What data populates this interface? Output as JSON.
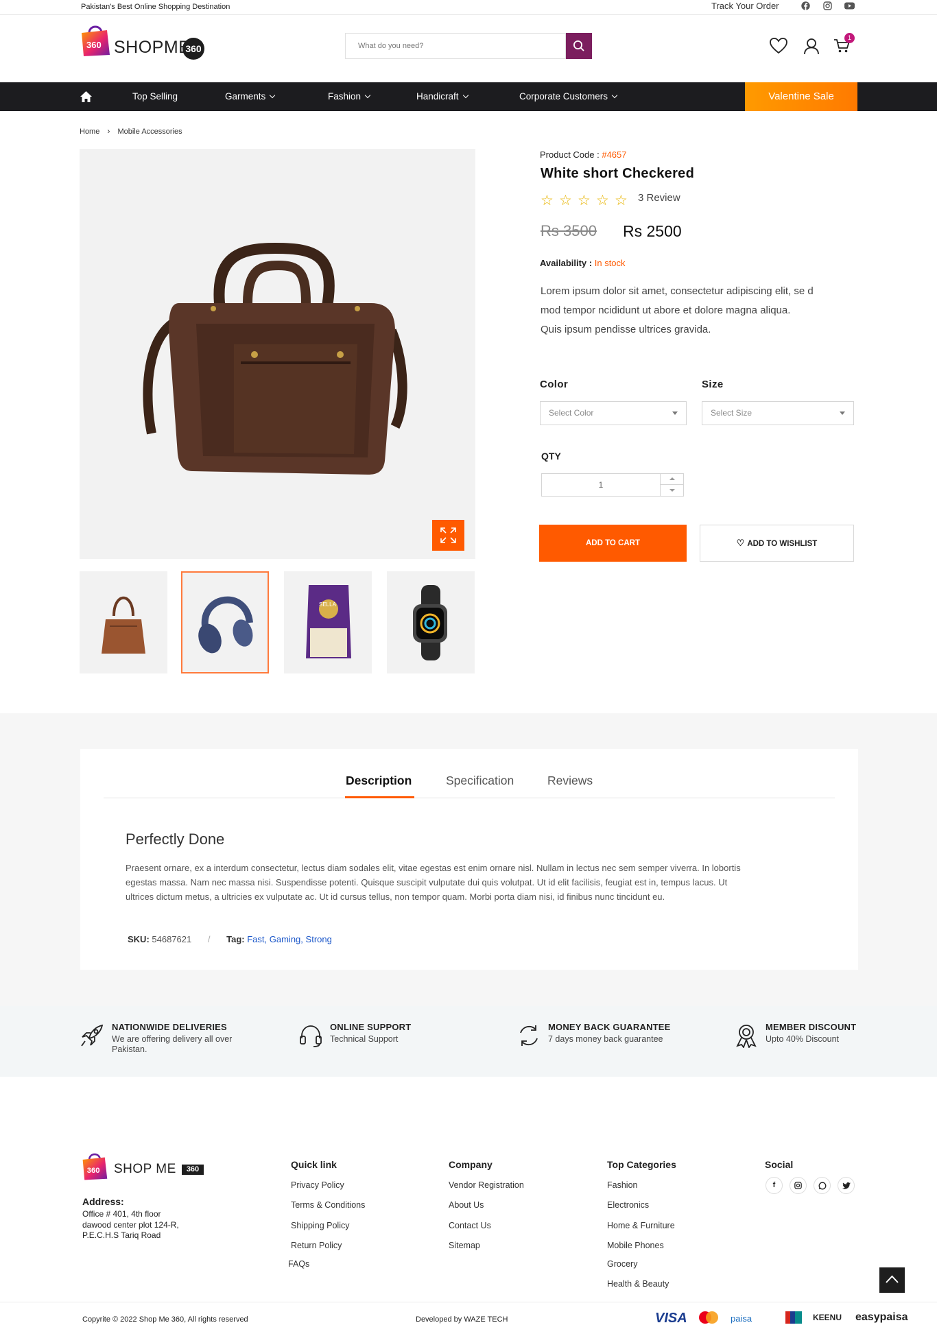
{
  "topbar": {
    "tagline": "Pakistan's Best Online Shopping Destination",
    "track_order": "Track Your Order"
  },
  "header": {
    "brand": "SHOPME",
    "brand_badge": "360",
    "search_placeholder": "What do you need?",
    "cart_count": "1"
  },
  "nav": {
    "items": [
      "Top Selling",
      "Garments",
      "Fashion",
      "Handicraft",
      "Corporate Customers"
    ],
    "sale": "Valentine Sale"
  },
  "breadcrumb": {
    "home": "Home",
    "current": "Mobile Accessories"
  },
  "product": {
    "code_label": "Product Code :",
    "code_value": "#4657",
    "title": "White short Checkered",
    "reviews": "3 Review",
    "rating": 0,
    "old_price": "Rs 3500",
    "price": "Rs 2500",
    "availability_label": "Availability :",
    "availability_value": "In stock",
    "summary_1": "Lorem ipsum dolor sit amet, consectetur adipiscing elit, se d",
    "summary_2": "mod tempor ncididunt ut abore et dolore magna aliqua.",
    "summary_3": "Quis ipsum pendisse ultrices gravida.",
    "color_label": "Color",
    "color_placeholder": "Select Color",
    "size_label": "Size",
    "size_placeholder": "Select Size",
    "qty_label": "QTY",
    "qty_value": "1",
    "add_to_cart": "ADD TO CART",
    "add_to_wishlist": "ADD TO WISHLIST"
  },
  "tabs": {
    "items": [
      "Description",
      "Specification",
      "Reviews"
    ],
    "active": "Description"
  },
  "description": {
    "heading": "Perfectly Done",
    "line_1": "Praesent ornare, ex a interdum consectetur, lectus diam sodales elit, vitae egestas est enim ornare nisl. Nullam in lectus nec sem semper viverra. In lobortis",
    "line_2": "egestas massa. Nam nec massa nisi. Suspendisse potenti. Quisque suscipit vulputate dui quis volutpat. Ut id elit facilisis, feugiat est in, tempus lacus. Ut",
    "line_3": "ultrices dictum metus, a ultricies ex vulputate ac. Ut id cursus tellus, non tempor quam. Morbi porta diam nisi, id finibus nunc tincidunt eu.",
    "sku_label": "SKU:",
    "sku_value": "54687621",
    "separator": "/",
    "tag_label": "Tag:",
    "tags": [
      "Fast,",
      "Gaming,",
      "Strong"
    ]
  },
  "features": [
    {
      "title": "NATIONWIDE DELIVERIES",
      "sub_1": "We are offering delivery all over",
      "sub_2": "Pakistan.",
      "icon": "rocket-icon"
    },
    {
      "title": "ONLINE SUPPORT",
      "sub_1": "Technical Support",
      "sub_2": "",
      "icon": "headset-icon"
    },
    {
      "title": "MONEY BACK GUARANTEE",
      "sub_1": "7 days money back guarantee",
      "sub_2": "",
      "icon": "refresh-icon"
    },
    {
      "title": "MEMBER DISCOUNT",
      "sub_1": "Upto 40% Discount",
      "sub_2": "",
      "icon": "award-icon"
    }
  ],
  "footer": {
    "brand": "SHOP ME",
    "brand_badge": "360",
    "address_label": "Address:",
    "address_1": "Office # 401, 4th floor",
    "address_2": "dawood center plot 124-R,",
    "address_3": "P.E.C.H.S Tariq Road",
    "quick_title": "Quick link",
    "quick": [
      "Privacy Policy",
      "Terms & Conditions",
      "Shipping Policy",
      "Return Policy",
      "FAQs"
    ],
    "company_title": "Company",
    "company": [
      "Vendor Registration",
      "About Us",
      "Contact Us",
      "Sitemap"
    ],
    "cat_title": "Top Categories",
    "cats": [
      "Fashion",
      "Electronics",
      "Home & Furniture",
      "Mobile Phones",
      "Grocery",
      "Health & Beauty"
    ],
    "social_title": "Social",
    "copyright": "Copyrite © 2022 Shop Me 360, All rights reserved",
    "developer": "Developed by WAZE TECH",
    "payments": [
      "VISA",
      "mastercard",
      "paisa",
      "KEENU",
      "easypaisa"
    ]
  },
  "colors": {
    "accent": "#ff5a00",
    "brand_purple": "#7b1e5e",
    "nav_bg": "#1c1c1f",
    "sale": "#ff8a00"
  }
}
